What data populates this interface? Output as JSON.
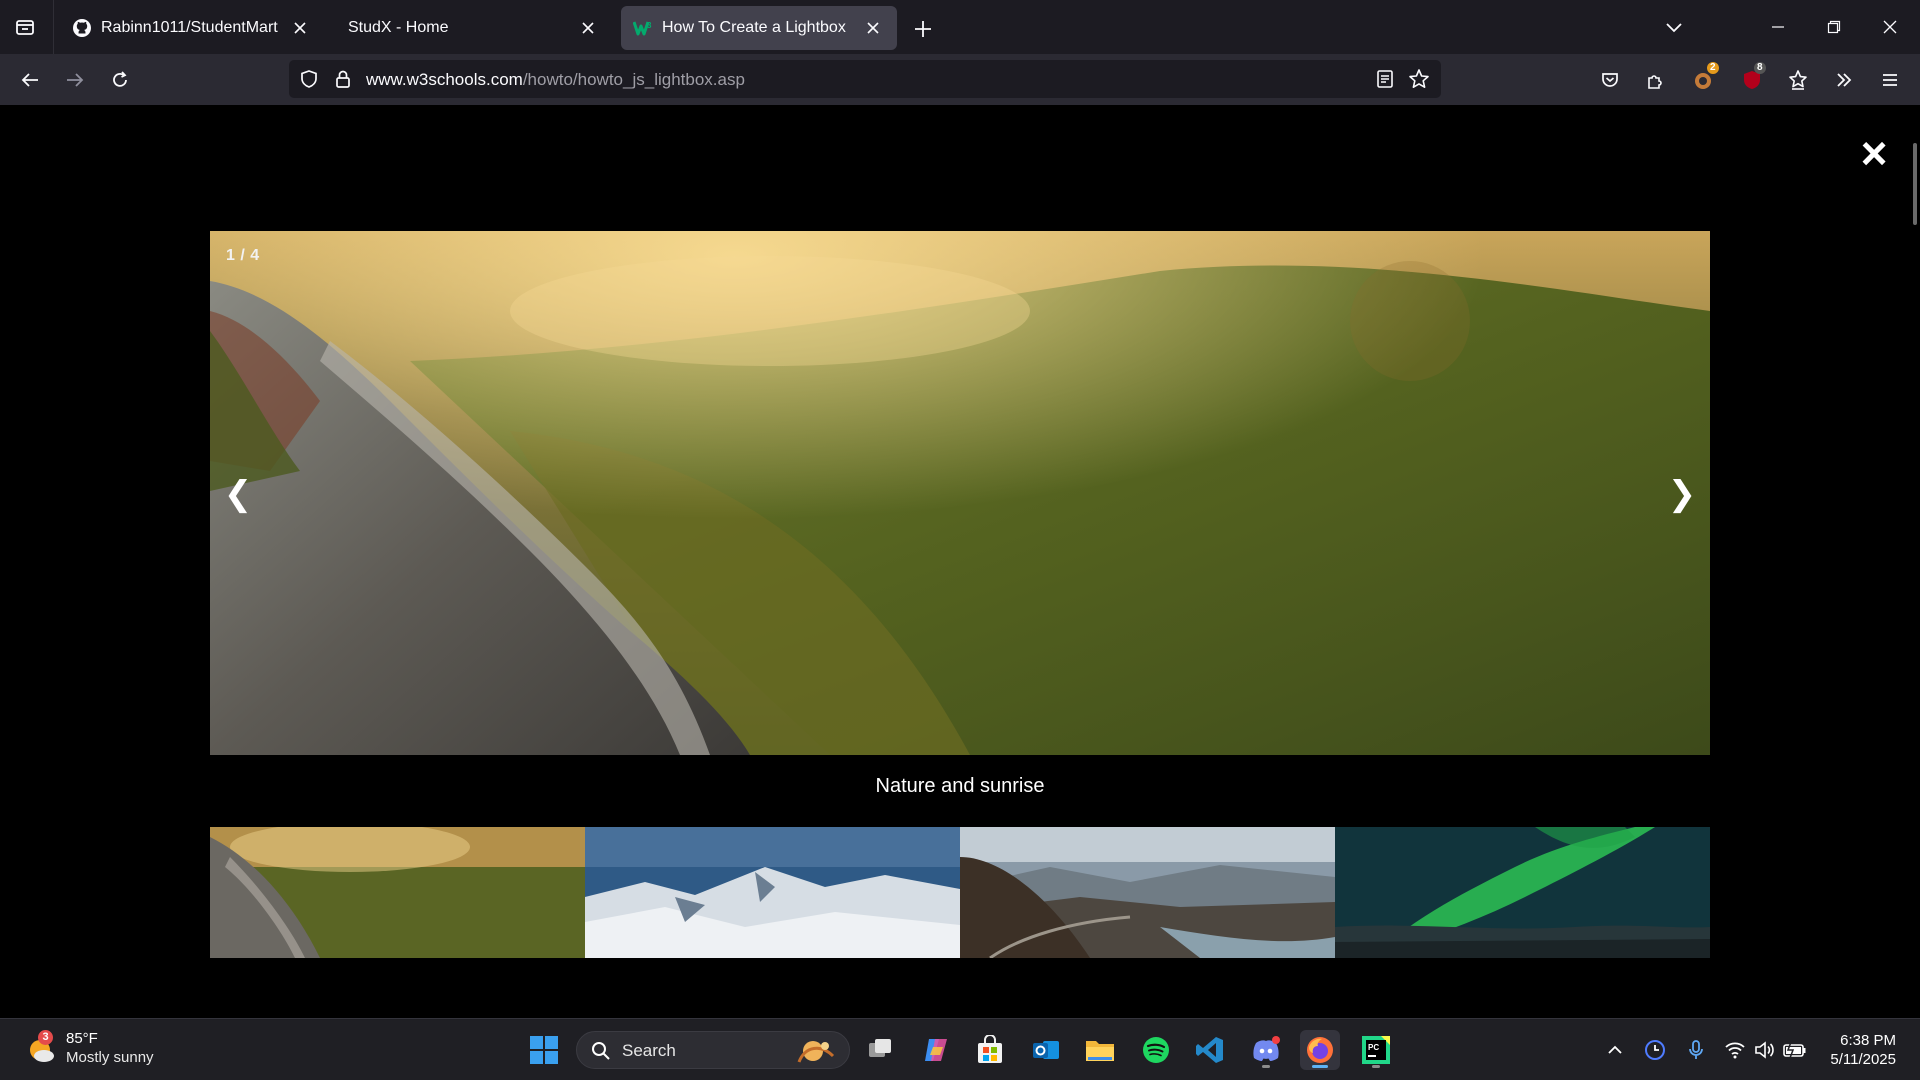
{
  "browser": {
    "tabs": [
      {
        "title": "Rabinn1011/StudentMart",
        "favicon": "github-icon"
      },
      {
        "title": "StudX - Home",
        "favicon": "none"
      },
      {
        "title": "How To Create a Lightbox",
        "favicon": "w3schools-icon"
      }
    ],
    "url": {
      "host": "www.w3schools.com",
      "path": "/howto/howto_js_lightbox.asp"
    },
    "badges": {
      "extension_a": "2",
      "extension_b": "8"
    }
  },
  "lightbox": {
    "counter": "1 / 4",
    "caption": "Nature and sunrise",
    "close_symbol": "×",
    "prev_symbol": "❮",
    "next_symbol": "❯",
    "thumbnails": [
      {
        "subject": "nature-sunrise",
        "active": true
      },
      {
        "subject": "snow-mountains",
        "active": false
      },
      {
        "subject": "mountains-road-lake",
        "active": false
      },
      {
        "subject": "northern-lights",
        "active": false
      }
    ]
  },
  "taskbar": {
    "weather": {
      "badge": "3",
      "temp": "85°F",
      "desc": "Mostly sunny"
    },
    "search_label": "Search",
    "clock": {
      "time": "6:38 PM",
      "date": "5/11/2025"
    }
  },
  "colors": {
    "tabbar_bg": "#1c1b22",
    "navbar_bg": "#2b2a33",
    "active_tab_bg": "#42414d",
    "page_bg": "#000000",
    "taskbar_bg": "#1f1f24"
  }
}
